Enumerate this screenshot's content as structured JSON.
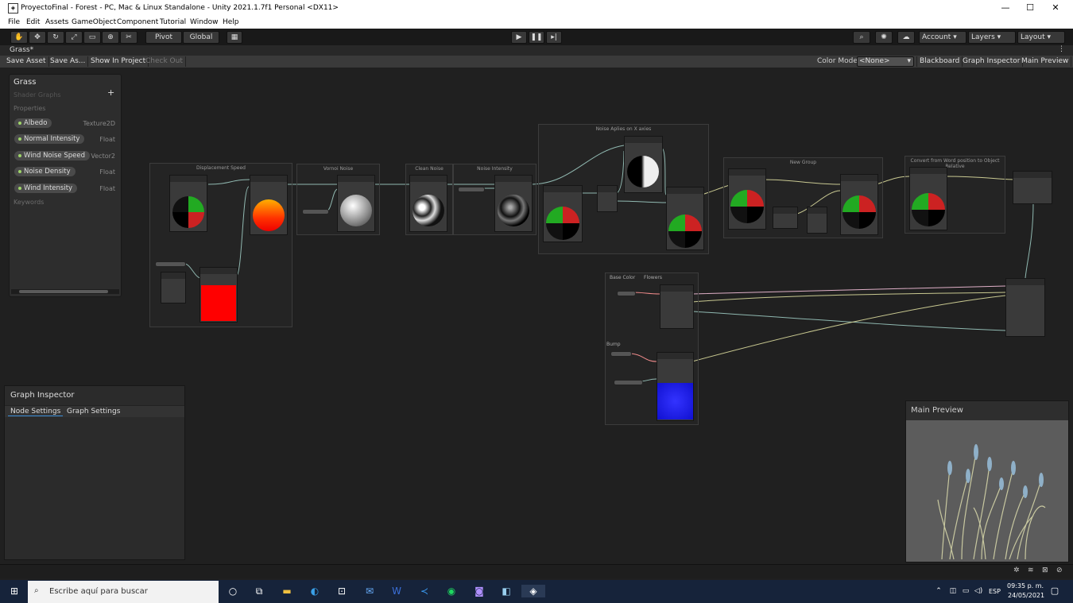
{
  "window": {
    "title": "ProyectoFinal - Forest - PC, Mac & Linux Standalone - Unity 2021.1.7f1 Personal <DX11>",
    "min": "—",
    "max": "☐",
    "close": "✕"
  },
  "menu": [
    "File",
    "Edit",
    "Assets",
    "GameObject",
    "Component",
    "Tutorial",
    "Window",
    "Help"
  ],
  "toolbar": {
    "pivot": "Pivot",
    "global": "Global",
    "account": "Account",
    "layers": "Layers",
    "layout": "Layout"
  },
  "tab": {
    "title": "Grass*"
  },
  "actions": {
    "save_asset": "Save Asset",
    "save_as": "Save As...",
    "show_in_project": "Show In Project",
    "check_out": "Check Out",
    "color_mode_label": "Color Mode",
    "color_mode_value": "<None>",
    "blackboard": "Blackboard",
    "graph_inspector": "Graph Inspector",
    "main_preview": "Main Preview"
  },
  "blackboard": {
    "title": "Grass",
    "subtitle": "Shader Graphs",
    "add": "+",
    "properties_label": "Properties",
    "keywords_label": "Keywords",
    "properties": [
      {
        "name": "Albedo",
        "type": "Texture2D"
      },
      {
        "name": "Normal Intensity",
        "type": "Float"
      },
      {
        "name": "Wind Noise Speed",
        "type": "Vector2"
      },
      {
        "name": "Noise Density",
        "type": "Float"
      },
      {
        "name": "Wind Intensity",
        "type": "Float"
      }
    ]
  },
  "inspector": {
    "title": "Graph Inspector",
    "tab_node": "Node Settings",
    "tab_graph": "Graph Settings"
  },
  "preview": {
    "title": "Main Preview"
  },
  "groups": {
    "displacement": "Displacement Speed",
    "voronoi": "Vornoi Noise",
    "clean": "Clean Noise",
    "intensity": "Noise Intensity",
    "apply": "Noise Aplies on X axies",
    "newgroup": "New Group",
    "convert": "Convert from Word position to Object Relative",
    "base": "Base Color",
    "flowers": "Flowers",
    "bump": "Bump"
  },
  "taskbar": {
    "search": "Escribe aquí para buscar",
    "lang": "ESP",
    "time": "09:35 p. m.",
    "date": "24/05/2021"
  }
}
